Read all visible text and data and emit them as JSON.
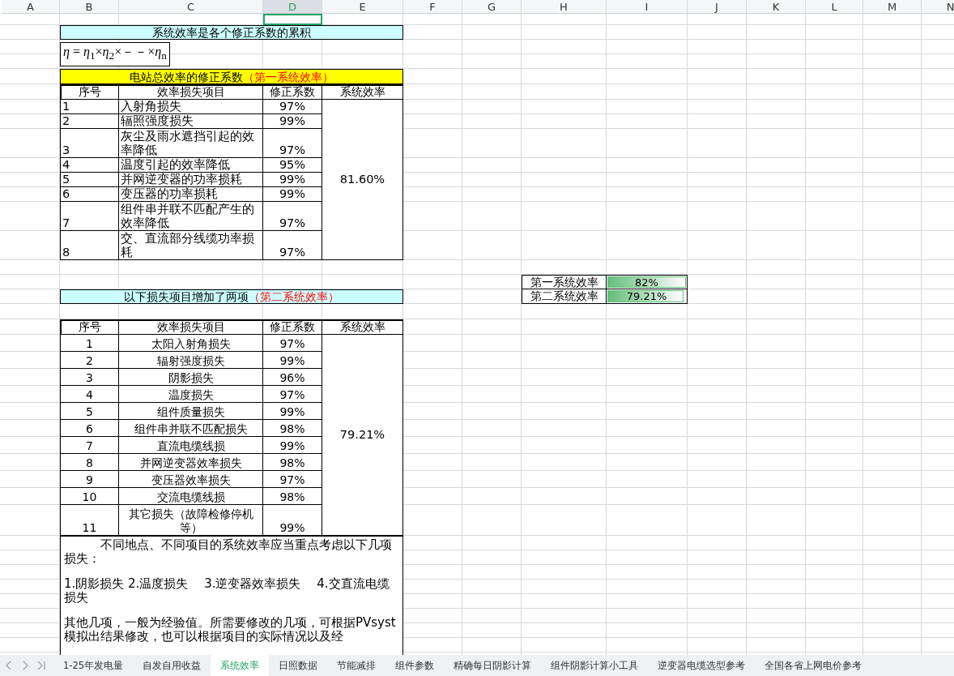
{
  "column_headers": [
    {
      "label": "A",
      "selected": false
    },
    {
      "label": "B",
      "selected": false
    },
    {
      "label": "C",
      "selected": false
    },
    {
      "label": "D",
      "selected": true
    },
    {
      "label": "E",
      "selected": false
    },
    {
      "label": "F",
      "selected": false
    },
    {
      "label": "G",
      "selected": false
    },
    {
      "label": "H",
      "selected": false
    },
    {
      "label": "I",
      "selected": false
    },
    {
      "label": "J",
      "selected": false
    },
    {
      "label": "K",
      "selected": false
    },
    {
      "label": "L",
      "selected": false
    },
    {
      "label": "M",
      "selected": false
    },
    {
      "label": "N",
      "selected": false
    }
  ],
  "heading": "系统效率是各个修正系数的累积",
  "formula": "*η* = *η*$_{1}$×*η*$_{2}$×－－×*η*$_{n}$",
  "table_1": {
    "title": "电站总效率的修正系数",
    "title_highlight": "（第一系统效率）",
    "columns": [
      "序号",
      "效率损失项目",
      "修正系数",
      "系统效率"
    ],
    "total": "81.60%",
    "rows": [
      {
        "no": "1",
        "item": "入射角损失",
        "factor": "97%"
      },
      {
        "no": "2",
        "item": "辐照强度损失",
        "factor": "99%"
      },
      {
        "no": "3",
        "item": "灰尘及雨水遮挡引起的效率降低",
        "factor": "97%"
      },
      {
        "no": "4",
        "item": "温度引起的效率降低",
        "factor": "95%"
      },
      {
        "no": "5",
        "item": "并网逆变器的功率损耗",
        "factor": "99%"
      },
      {
        "no": "6",
        "item": "变压器的功率损耗",
        "factor": "99%"
      },
      {
        "no": "7",
        "item": "组件串并联不匹配产生的效率降低",
        "factor": "97%"
      },
      {
        "no": "8",
        "item": "交、直流部分线缆功率损耗",
        "factor": "97%"
      }
    ]
  },
  "table_2": {
    "title": "以下损失项目增加了两项",
    "title_highlight": "（第二系统效率）",
    "columns": [
      "序号",
      "效率损失项目",
      "修正系数",
      "系统效率"
    ],
    "total": "79.21%",
    "rows": [
      {
        "no": "1",
        "item": "太阳入射角损失",
        "factor": "97%"
      },
      {
        "no": "2",
        "item": "辐射强度损失",
        "factor": "99%"
      },
      {
        "no": "3",
        "item": "阴影损失",
        "factor": "96%"
      },
      {
        "no": "4",
        "item": "温度损失",
        "factor": "97%"
      },
      {
        "no": "5",
        "item": "组件质量损失",
        "factor": "99%"
      },
      {
        "no": "6",
        "item": "组件串并联不匹配损失",
        "factor": "98%"
      },
      {
        "no": "7",
        "item": "直流电缆线损",
        "factor": "99%"
      },
      {
        "no": "8",
        "item": "并网逆变器效率损失",
        "factor": "98%"
      },
      {
        "no": "9",
        "item": "变压器效率损失",
        "factor": "97%"
      },
      {
        "no": "10",
        "item": "交流电缆线损",
        "factor": "98%"
      },
      {
        "no": "11",
        "item": "其它损失（故障检修停机等）",
        "factor": "99%"
      }
    ]
  },
  "summary": [
    {
      "label": "第一系统效率",
      "value": "82%",
      "level": 0.98
    },
    {
      "label": "第二系统效率",
      "value": "79.21%",
      "level": 0.95
    }
  ],
  "note": [
    "不同地点、不同项目的系统效率应当重点考虑以下几项损失：",
    "1.阴影损失 2.温度损失　 3.逆变器效率损失　 4.交直流电缆损失",
    "其他几项，一般为经验值。所需要修改的几项，可根据PVsyst模拟出结果修改，也可以根据项目的实际情况以及经"
  ],
  "sheet_tabs": [
    {
      "label": "1-25年发电量",
      "selected": false
    },
    {
      "label": "自发自用收益",
      "selected": false
    },
    {
      "label": "系统效率",
      "selected": true
    },
    {
      "label": "日照数据",
      "selected": false
    },
    {
      "label": "节能减排",
      "selected": false
    },
    {
      "label": "组件参数",
      "selected": false
    },
    {
      "label": "精确每日阴影计算",
      "selected": false
    },
    {
      "label": "组件阴影计算小工具",
      "selected": false
    },
    {
      "label": "逆变器电缆选型参考",
      "selected": false
    },
    {
      "label": "全国各省上网电价参考",
      "selected": false
    }
  ]
}
